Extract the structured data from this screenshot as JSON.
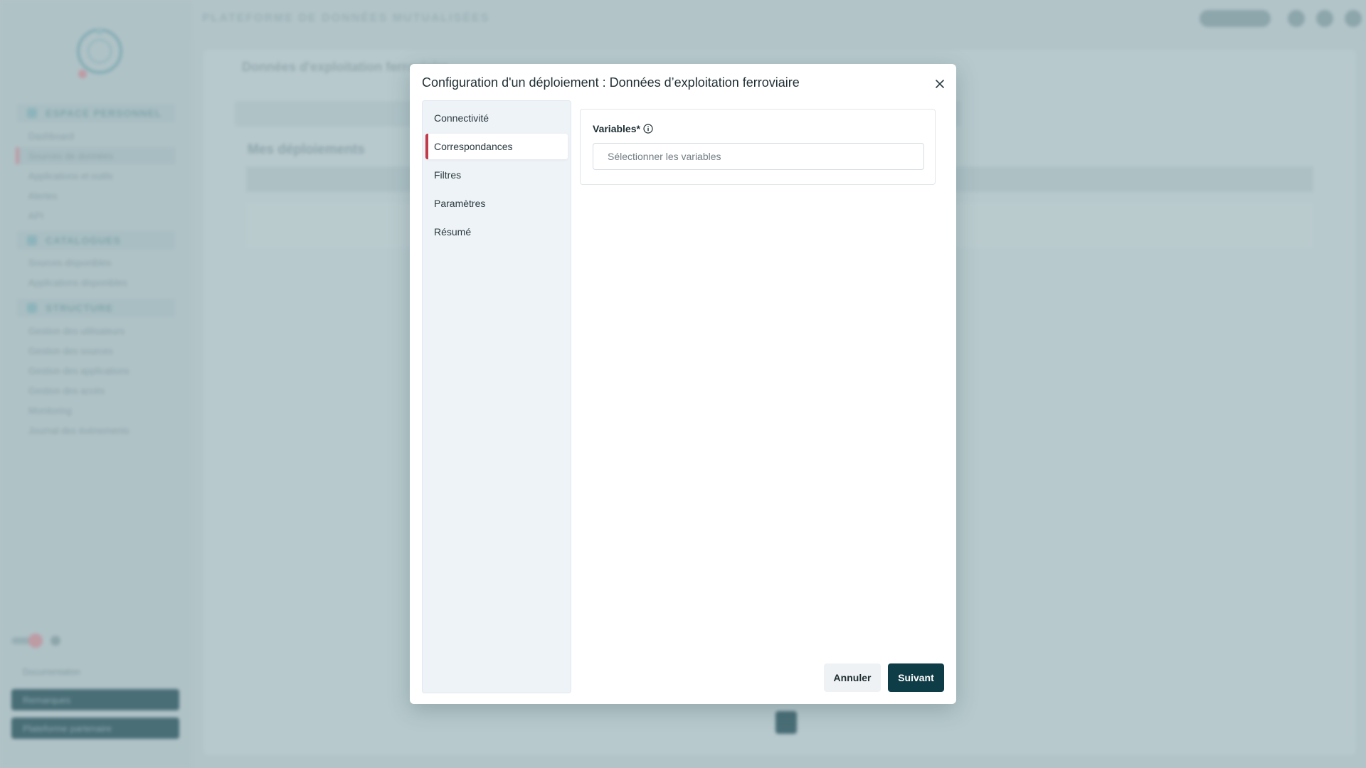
{
  "background": {
    "topbar_title": "PLATEFORME DE DONNÉES MUTUALISÉES",
    "sidebar": {
      "sections": [
        {
          "label": "ESPACE PERSONNEL",
          "items": [
            "Dashboard",
            "Sources de données",
            "Applications et outils",
            "Alertes",
            "API"
          ]
        },
        {
          "label": "CATALOGUES",
          "items": [
            "Sources disponibles",
            "Applications disponibles"
          ]
        },
        {
          "label": "STRUCTURE",
          "items": [
            "Gestion des utilisateurs",
            "Gestion des sources",
            "Gestion des applications",
            "Gestion des accès",
            "Monitoring",
            "Journal des événements"
          ]
        }
      ],
      "documentation": "Documentation",
      "buttons": [
        "Remarques",
        "Plateforme partenaire"
      ]
    },
    "main": {
      "title": "Données d'exploitation ferroviaire",
      "heading": "Mes déploiements"
    }
  },
  "modal": {
    "title": "Configuration d'un déploiement : Données d’exploitation ferroviaire",
    "close_icon": "close-icon",
    "steps": [
      {
        "label": "Connectivité",
        "active": false
      },
      {
        "label": "Correspondances",
        "active": true
      },
      {
        "label": "Filtres",
        "active": false
      },
      {
        "label": "Paramètres",
        "active": false
      },
      {
        "label": "Résumé",
        "active": false
      }
    ],
    "variables": {
      "label": "Variables*",
      "info_icon": "info-icon",
      "value": "",
      "placeholder": "Sélectionner les variables"
    },
    "cancel_label": "Annuler",
    "next_label": "Suivant"
  },
  "colors": {
    "accent_active_step": "#c13a4a",
    "primary_button": "#0f3d47"
  }
}
